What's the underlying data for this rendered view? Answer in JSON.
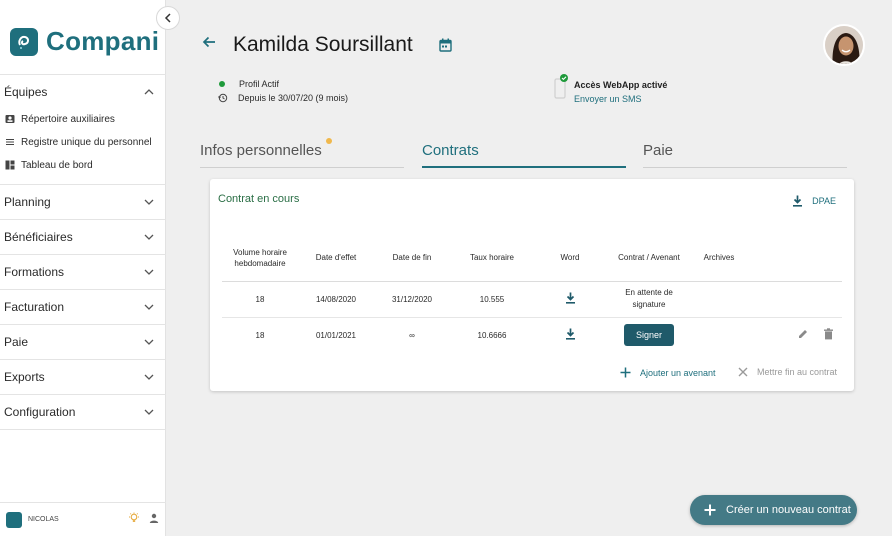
{
  "app": {
    "name": "Compani"
  },
  "sidebar": {
    "sections": [
      {
        "label": "Équipes",
        "expanded": true,
        "items": [
          {
            "label": "Répertoire auxiliaires",
            "icon": "contact-card-icon"
          },
          {
            "label": "Registre unique du personnel",
            "icon": "list-icon"
          },
          {
            "label": "Tableau de bord",
            "icon": "dashboard-icon"
          }
        ]
      },
      {
        "label": "Planning"
      },
      {
        "label": "Bénéficiaires"
      },
      {
        "label": "Formations"
      },
      {
        "label": "Facturation"
      },
      {
        "label": "Paie"
      },
      {
        "label": "Exports"
      },
      {
        "label": "Configuration"
      }
    ],
    "footer": {
      "user": "NICOLAS"
    }
  },
  "header": {
    "name": "Kamilda Soursillant",
    "status": "Profil Actif",
    "since": "Depuis le 30/07/20 (9 mois)",
    "webapp_title": "Accès WebApp activé",
    "webapp_link": "Envoyer un SMS"
  },
  "tabs": [
    {
      "label": "Infos personnelles"
    },
    {
      "label": "Contrats"
    },
    {
      "label": "Paie"
    }
  ],
  "card": {
    "title": "Contrat en cours",
    "dpae": "DPAE",
    "columns": [
      "Volume horaire hebdomadaire",
      "Date d'effet",
      "Date de fin",
      "Taux horaire",
      "Word",
      "Contrat / Avenant",
      "Archives"
    ],
    "rows": [
      {
        "volume": "18",
        "start": "14/08/2020",
        "end": "31/12/2020",
        "rate": "10.555",
        "contract_status": "En attente de signature"
      },
      {
        "volume": "18",
        "start": "01/01/2021",
        "end": "∞",
        "rate": "10.6666",
        "sign_label": "Signer"
      }
    ],
    "add_avenant": "Ajouter un avenant",
    "end_contract": "Mettre fin au contrat"
  },
  "fab": {
    "label": "Créer un nouveau contrat"
  },
  "colors": {
    "brand": "#1f6f7d",
    "active_green": "#1f9a3b",
    "notification": "#f0b84c"
  }
}
